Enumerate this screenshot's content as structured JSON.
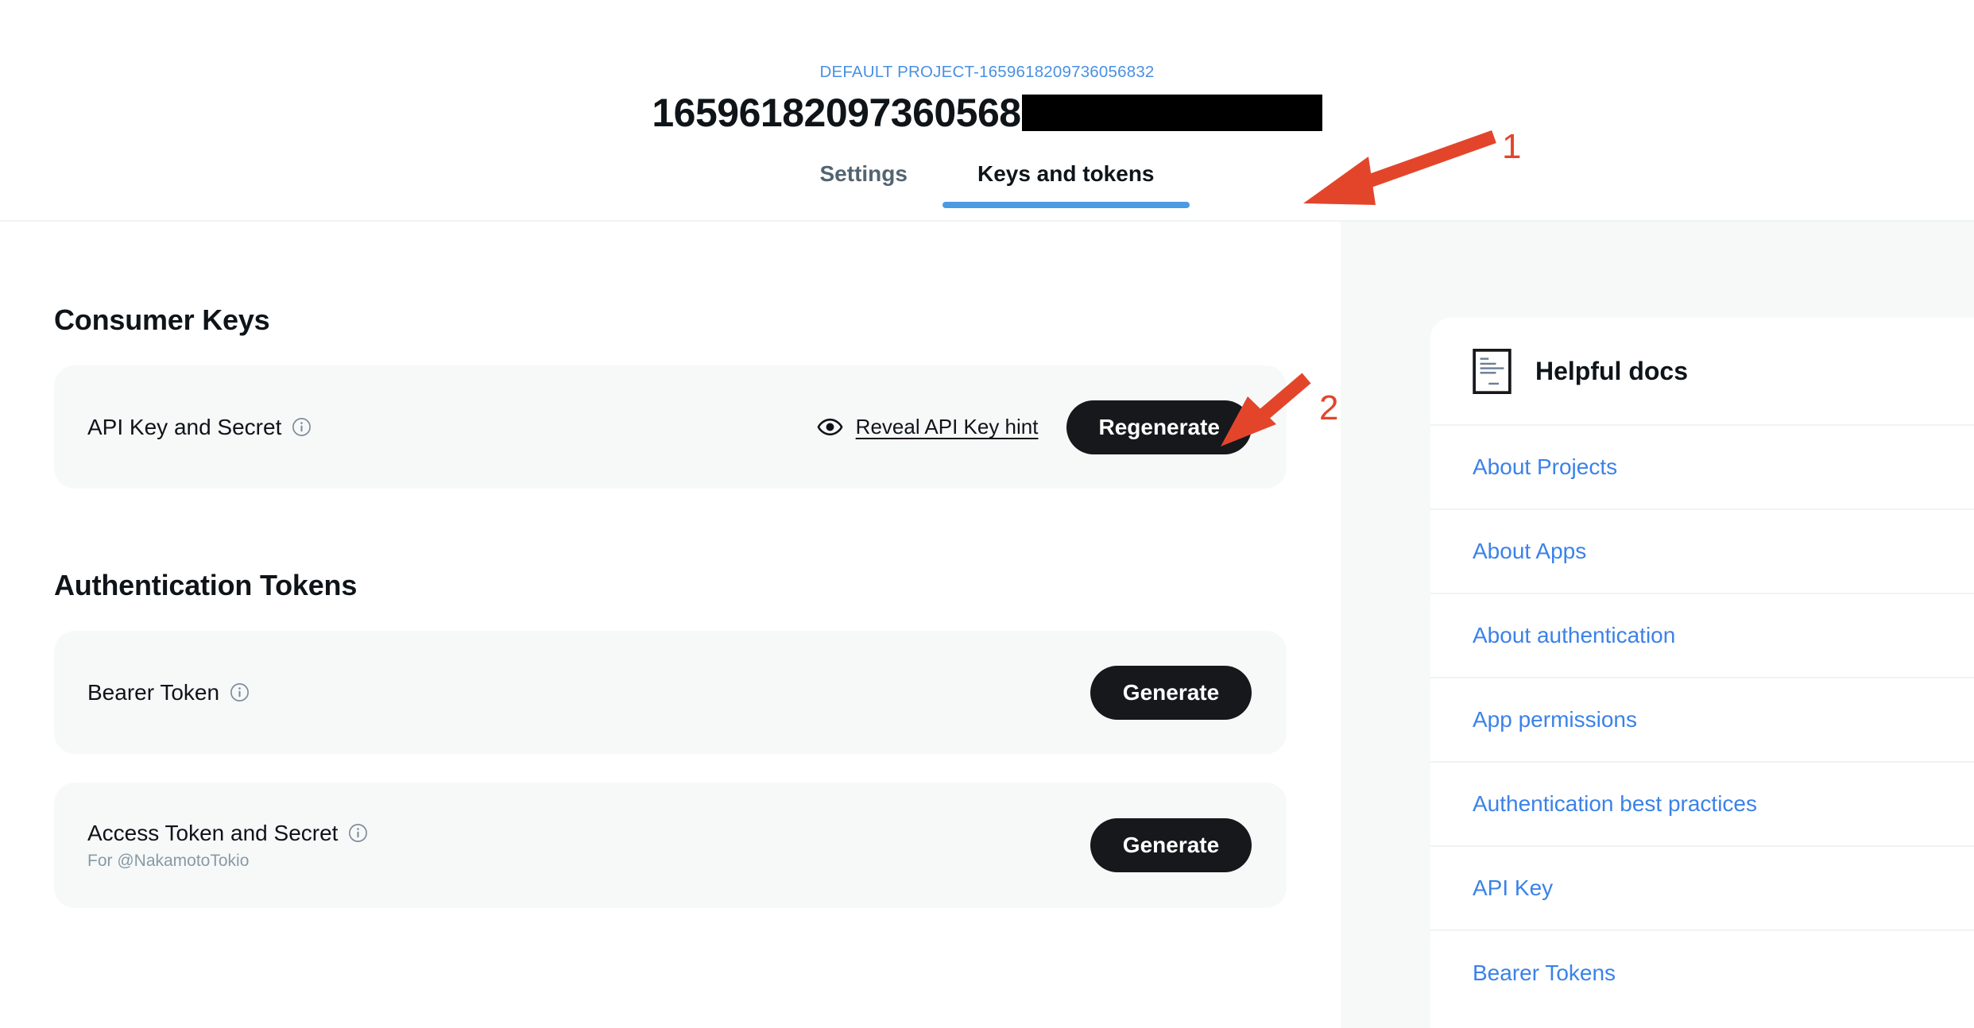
{
  "header": {
    "project_label": "DEFAULT PROJECT-1659618209736056832",
    "app_title": "16596182097360568",
    "app_title_redacted": true,
    "tabs": [
      {
        "label": "Settings",
        "active": false
      },
      {
        "label": "Keys and tokens",
        "active": true
      }
    ]
  },
  "main": {
    "consumer_keys": {
      "title": "Consumer Keys",
      "row": {
        "label": "API Key and Secret",
        "info_icon": "info-icon",
        "reveal_icon": "eye-icon",
        "reveal_label": "Reveal API Key hint",
        "button_label": "Regenerate"
      }
    },
    "authentication_tokens": {
      "title": "Authentication Tokens",
      "rows": [
        {
          "label": "Bearer Token",
          "sublabel": "",
          "info_icon": "info-icon",
          "button_label": "Generate"
        },
        {
          "label": "Access Token and Secret",
          "sublabel": "For @NakamotoTokio",
          "info_icon": "info-icon",
          "button_label": "Generate"
        }
      ]
    }
  },
  "sidebar": {
    "icon": "document-icon",
    "title": "Helpful docs",
    "links": [
      {
        "label": "About Projects"
      },
      {
        "label": "About Apps"
      },
      {
        "label": "About authentication"
      },
      {
        "label": "App permissions"
      },
      {
        "label": "Authentication best practices"
      },
      {
        "label": "API Key"
      },
      {
        "label": "Bearer Tokens"
      }
    ]
  },
  "annotations": [
    {
      "number": "1",
      "target": "keys-and-tokens-tab"
    },
    {
      "number": "2",
      "target": "regenerate-button"
    }
  ],
  "colors": {
    "accent_blue": "#4a9ae4",
    "link_blue": "#3b82e8",
    "button_dark": "#16181c",
    "card_bg": "#f7f9f9",
    "annotation_red": "#e3452b",
    "text_primary": "#0f1419",
    "text_muted": "#536471"
  }
}
